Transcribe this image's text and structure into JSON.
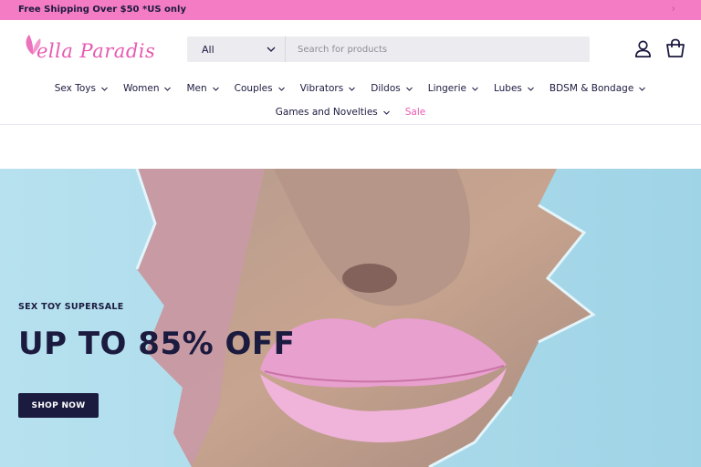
{
  "announcement": {
    "text": "Free Shipping Over $50 *US only"
  },
  "brand": {
    "logo_text": "ella Paradis",
    "accent_color": "#e85ab1",
    "announce_bg": "#f47cc4",
    "ink": "#1b1a3f"
  },
  "search": {
    "category_selected": "All",
    "placeholder": "Search for products"
  },
  "header_icons": {
    "account": "user-icon",
    "cart": "shopping-bag-icon"
  },
  "nav": {
    "row1": [
      {
        "label": "Sex Toys"
      },
      {
        "label": "Women"
      },
      {
        "label": "Men"
      },
      {
        "label": "Couples"
      },
      {
        "label": "Vibrators"
      },
      {
        "label": "Dildos"
      },
      {
        "label": "Lingerie"
      },
      {
        "label": "Lubes"
      },
      {
        "label": "BDSM & Bondage"
      }
    ],
    "row2": [
      {
        "label": "Games and Novelties"
      },
      {
        "label": "Sale"
      }
    ]
  },
  "hero": {
    "eyebrow": "SEX TOY SUPERSALE",
    "heading": "UP TO 85% OFF",
    "cta_label": "SHOP NOW"
  }
}
